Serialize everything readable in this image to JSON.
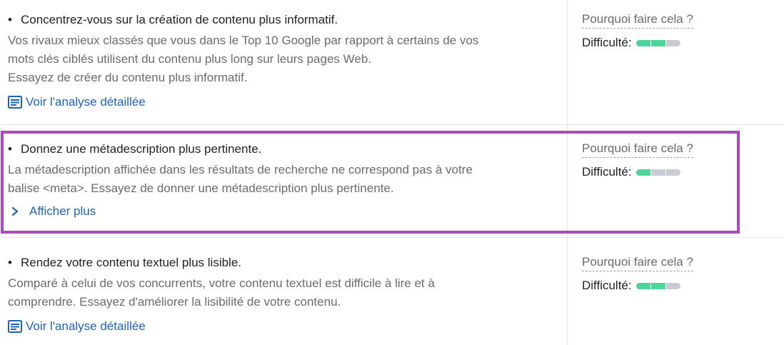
{
  "colors": {
    "highlight": "#b046bf",
    "link": "#1f63b8",
    "difficulty_filled": "#4ed59b",
    "difficulty_empty": "#c9ccd4"
  },
  "recommendations": [
    {
      "title": "Concentrez-vous sur la création de contenu plus informatif.",
      "description_lines": [
        "Vos rivaux mieux classés que vous dans le Top 10 Google par rapport à certains de vos",
        "mots clés ciblés utilisent du contenu plus long sur leurs pages Web.",
        "Essayez de créer du contenu plus informatif."
      ],
      "link_label": "Voir l'analyse détaillée",
      "link_icon": "document-icon",
      "why_label": "Pourquoi faire cela ?",
      "difficulty_label": "Difficulté:",
      "difficulty_level": 2,
      "difficulty_max": 3
    },
    {
      "title": "Donnez une métadescription plus pertinente.",
      "description_lines": [
        "La métadescription affichée dans les résultats de recherche ne correspond pas à votre",
        "balise <meta>. Essayez de donner une métadescription plus pertinente."
      ],
      "link_label": "Afficher plus",
      "link_icon": "chevron-right-icon",
      "why_label": "Pourquoi faire cela ?",
      "difficulty_label": "Difficulté:",
      "difficulty_level": 1,
      "difficulty_max": 3
    },
    {
      "title": "Rendez votre contenu textuel plus lisible.",
      "description_lines": [
        "Comparé à celui de vos concurrents, votre contenu textuel est difficile à lire et à",
        "comprendre. Essayez d'améliorer la lisibilité de votre contenu."
      ],
      "link_label": "Voir l'analyse détaillée",
      "link_icon": "document-icon",
      "why_label": "Pourquoi faire cela ?",
      "difficulty_label": "Difficulté:",
      "difficulty_level": 2,
      "difficulty_max": 3
    }
  ]
}
